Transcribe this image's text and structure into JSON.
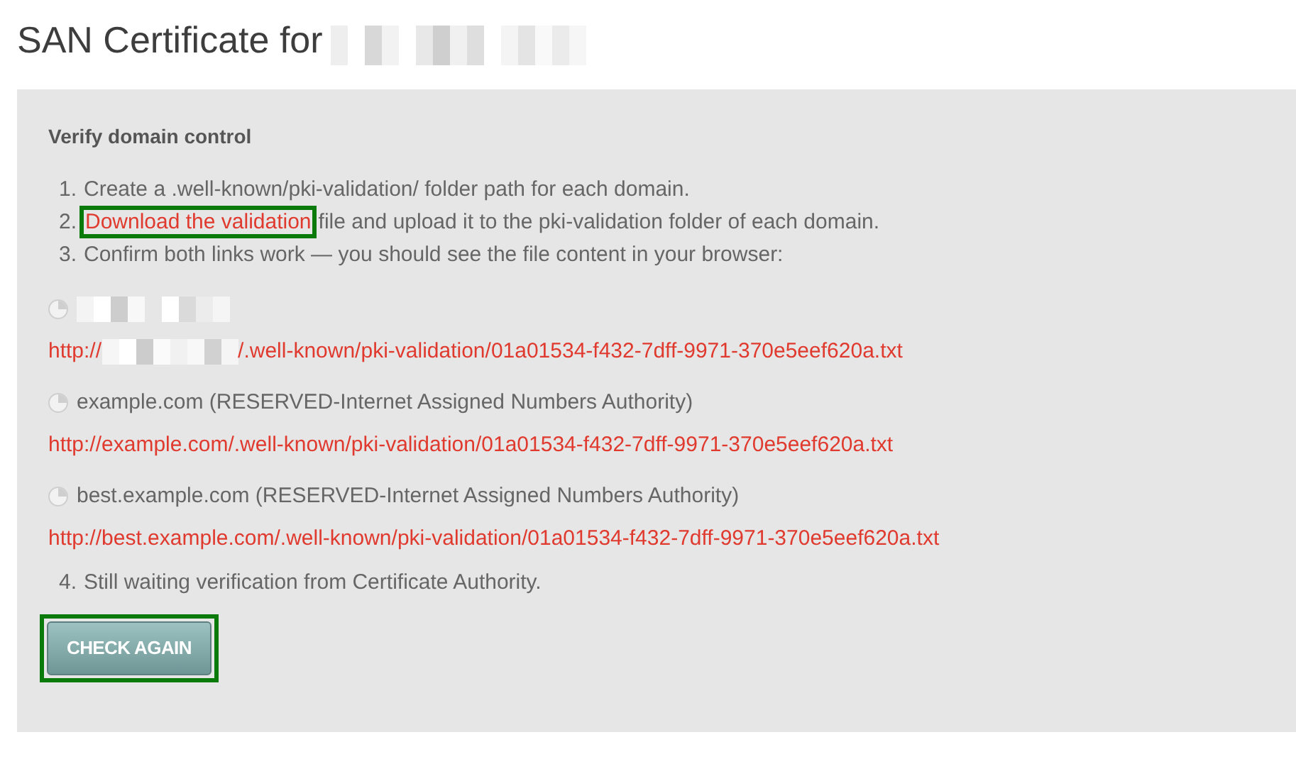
{
  "title": "SAN Certificate for",
  "title_redacted": true,
  "panel": {
    "heading": "Verify domain control",
    "steps": [
      {
        "number": "1.",
        "text": "Create a .well-known/pki-validation/ folder path for each domain."
      },
      {
        "number": "2.",
        "link": {
          "text": "Download the validation",
          "highlighted": true
        },
        "text": "file and upload it to the pki-validation folder of each domain."
      },
      {
        "number": "3.",
        "text": "Confirm both links work — you should see the file content in your browser:"
      }
    ],
    "domains": [
      {
        "kind": "redacted",
        "url_prefix": "http://",
        "url_suffix": "/.well-known/pki-validation/01a01534-f432-7dff-9971-370e5eef620a.txt"
      },
      {
        "kind": "plain",
        "name": "example.com (RESERVED-Internet Assigned Numbers Authority)",
        "url": "http://example.com/.well-known/pki-validation/01a01534-f432-7dff-9971-370e5eef620a.txt"
      },
      {
        "kind": "plain",
        "name": "best.example.com (RESERVED-Internet Assigned Numbers Authority)",
        "url": "http://best.example.com/.well-known/pki-validation/01a01534-f432-7dff-9971-370e5eef620a.txt"
      }
    ],
    "final_step": {
      "number": "4.",
      "text": "Still waiting verification from Certificate Authority."
    },
    "button": {
      "label": "CHECK AGAIN",
      "highlighted": true
    }
  }
}
